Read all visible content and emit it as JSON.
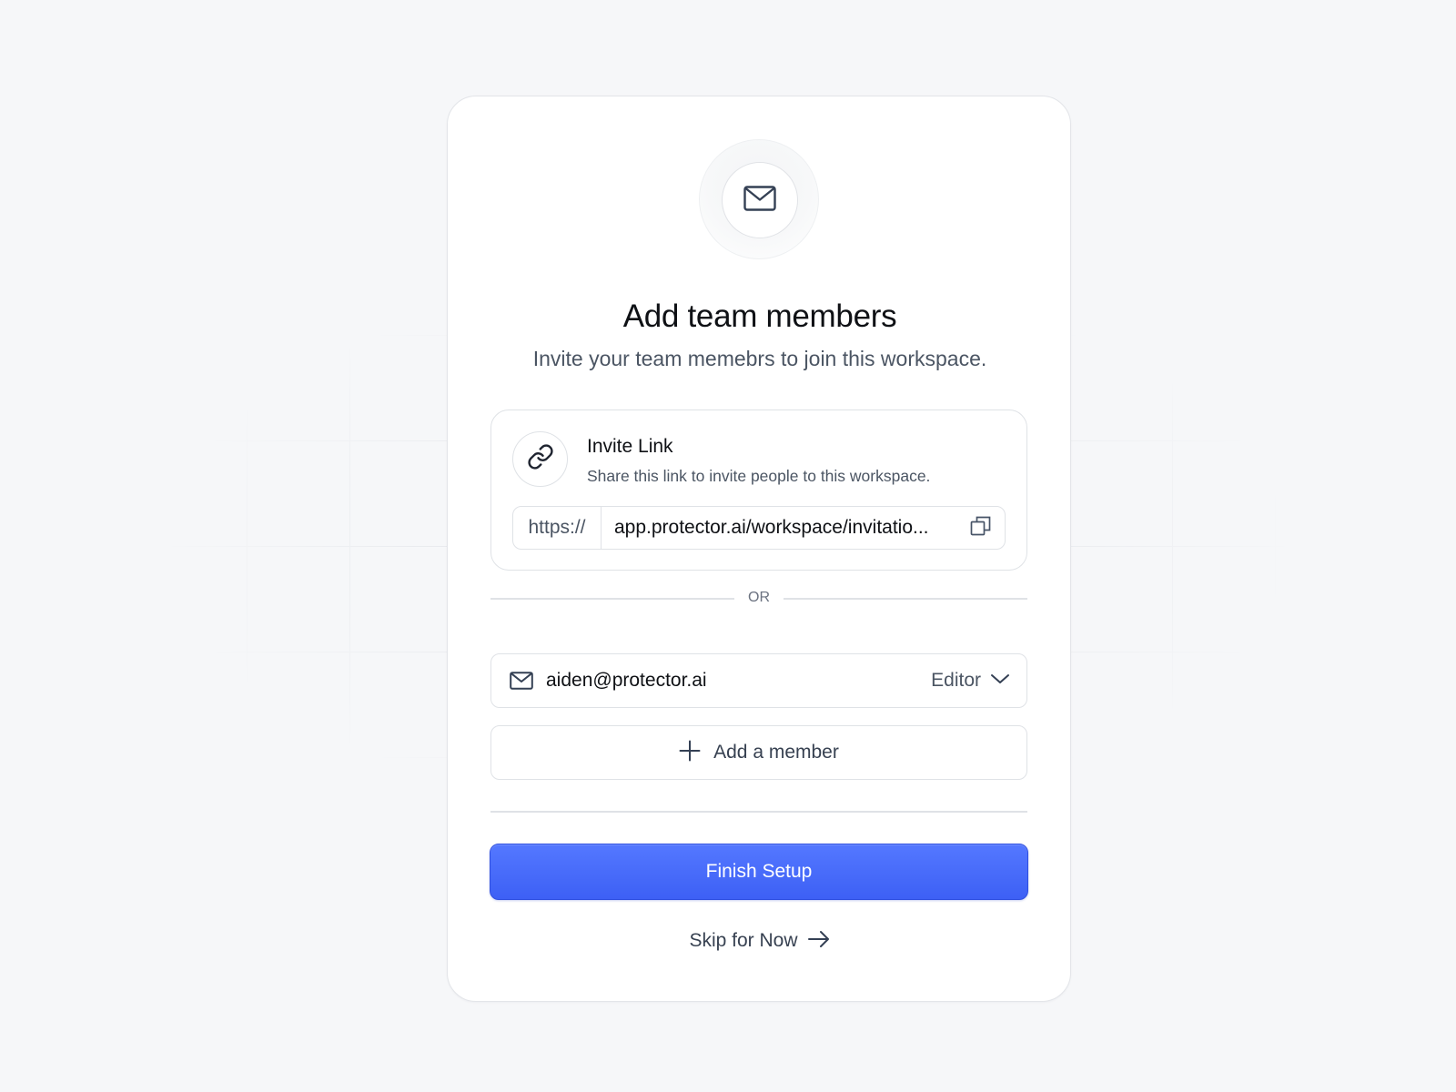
{
  "header": {
    "title": "Add team members",
    "subtitle": "Invite your team memebrs to join this workspace."
  },
  "invite_link": {
    "title": "Invite Link",
    "description": "Share this link to invite people to this workspace.",
    "url_prefix": "https://",
    "url_value": "app.protector.ai/workspace/invitatio..."
  },
  "divider": {
    "label": "OR"
  },
  "members": [
    {
      "email": "aiden@protector.ai",
      "role": "Editor"
    }
  ],
  "actions": {
    "add_member_label": "Add a member",
    "finish_label": "Finish Setup",
    "skip_label": "Skip for Now"
  },
  "icons": {
    "header": "mail-icon",
    "invite": "link-icon",
    "copy": "copy-icon",
    "member": "mail-icon",
    "role": "chevron-down-icon",
    "add": "plus-icon",
    "skip": "arrow-right-icon"
  },
  "colors": {
    "primary": "#3d60f5",
    "background": "#f6f7f9",
    "card": "#ffffff",
    "border": "#dfe2e6"
  }
}
